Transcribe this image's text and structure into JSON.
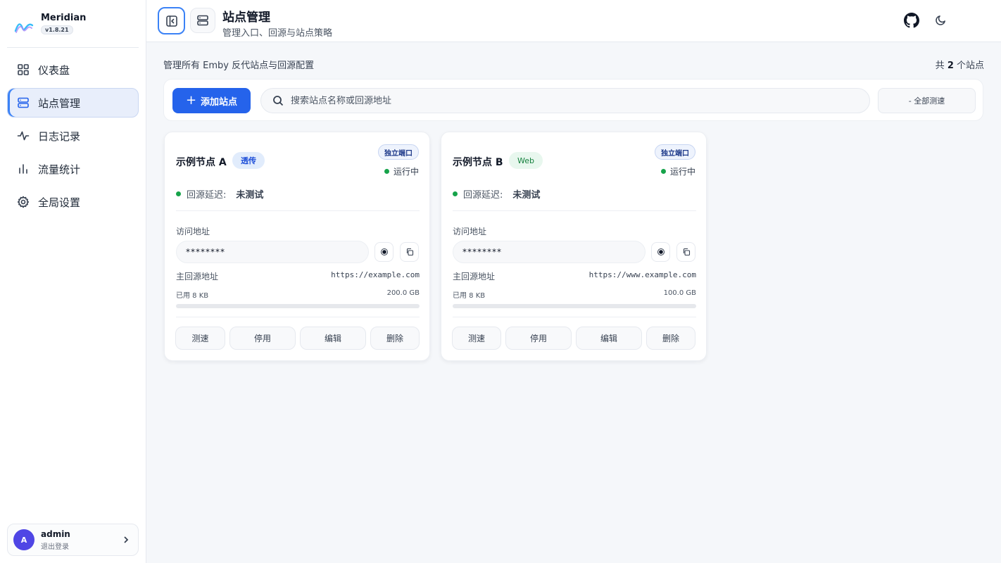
{
  "app": {
    "name": "Meridian",
    "version": "v1.8.21"
  },
  "nav": [
    {
      "label": "仪表盘",
      "icon": "grid-icon",
      "active": false
    },
    {
      "label": "站点管理",
      "icon": "server-icon",
      "active": true
    },
    {
      "label": "日志记录",
      "icon": "activity-icon",
      "active": false
    },
    {
      "label": "流量统计",
      "icon": "bar-chart-icon",
      "active": false
    },
    {
      "label": "全局设置",
      "icon": "gear-icon",
      "active": false
    }
  ],
  "user": {
    "avatar": "A",
    "name": "admin",
    "logout": "退出登录"
  },
  "header": {
    "title": "站点管理",
    "subtitle": "管理入口、回源与站点策略"
  },
  "main": {
    "summary": "管理所有 Emby 反代站点与回源配置",
    "count_prefix": "共 ",
    "count": "2",
    "count_suffix": " 个站点"
  },
  "toolbar": {
    "add_label": "添加站点",
    "search_placeholder": "搜索站点名称或回源地址",
    "test_all_label": "- 全部测速"
  },
  "colors": {
    "accent": "#2563eb",
    "status_ok": "#16a34a"
  },
  "sites": [
    {
      "name": "示例节点 A",
      "mode": "透传",
      "port_badge": "独立端口",
      "status": "运行中",
      "latency_label": "回源延迟:",
      "latency_value": "未测试",
      "access_label": "访问地址",
      "access_value": "********",
      "origin_label": "主回源地址",
      "origin_value": "https://example.com",
      "used": "已用 8 KB",
      "quota": "200.0 GB",
      "usage_fraction": 4e-08,
      "actions": [
        "测速",
        "停用",
        "编辑",
        "删除"
      ]
    },
    {
      "name": "示例节点 B",
      "mode": "Web",
      "port_badge": "独立端口",
      "status": "运行中",
      "latency_label": "回源延迟:",
      "latency_value": "未测试",
      "access_label": "访问地址",
      "access_value": "********",
      "origin_label": "主回源地址",
      "origin_value": "https://www.example.com",
      "used": "已用 8 KB",
      "quota": "100.0 GB",
      "usage_fraction": 8e-08,
      "actions": [
        "测速",
        "停用",
        "编辑",
        "删除"
      ]
    }
  ]
}
